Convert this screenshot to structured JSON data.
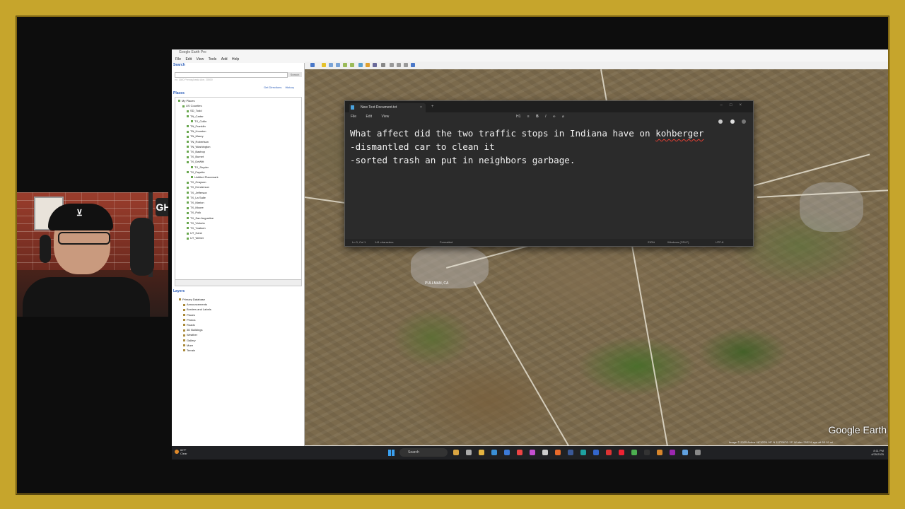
{
  "colors": {
    "frame": "#c6a52c",
    "notepad_bg": "#2b2b2b",
    "spell_error": "#e03c31",
    "link_blue": "#2a5cb8"
  },
  "webcam": {
    "logo_text": "GH"
  },
  "google_earth": {
    "title": "Google Earth Pro",
    "menu": [
      "File",
      "Edit",
      "View",
      "Tools",
      "Add",
      "Help"
    ],
    "search_header": "Search",
    "search_button": "Search",
    "search_hint": "ex: 1600 Pennsylvania Ave, 20500",
    "links": [
      "Get Directions",
      "History"
    ],
    "places_header": "Places",
    "tree": [
      "My Places",
      "US Counties",
      "SD_Todd",
      "TN_Carter",
      "TX_Collin",
      "TN_Franklin",
      "TN_Houston",
      "TN_Maury",
      "TN_Robertson",
      "TN_Washington",
      "TX_Bastrop",
      "TX_Burnet",
      "TX_DeWitt",
      "TX_Snyder",
      "TX_Fayette",
      "Untitled Placemark",
      "TX_Grayson",
      "TX_Henderson",
      "TX_Jefferson",
      "TX_La Salle",
      "TX_Marion",
      "TX_Moore",
      "TX_Polk",
      "TX_San Augustine",
      "TX_Victoria",
      "TX_Yoakum",
      "UT_Kane",
      "UT_Weber"
    ],
    "layers_header": "Layers",
    "layers": [
      "Primary Database",
      "Announcements",
      "Borders and Labels",
      "Places",
      "Photos",
      "Roads",
      "3D Buildings",
      "Weather",
      "Gallery",
      "More",
      "Terrain"
    ],
    "map_logo": "Google Earth",
    "map_town_label": "PULLMAN, CA",
    "status_text": "Image © 2025 Airbus  46°43'24.95\" N 117°08'32.13\" W  elev 2532 ft  eye alt 53.19 mi"
  },
  "notepad": {
    "tab_title": "New Text Document.txt",
    "menu": [
      "File",
      "Edit",
      "View"
    ],
    "format_controls": [
      "H1",
      "≡",
      "B",
      "I",
      "∞",
      "⌀"
    ],
    "line1_before": "What affect did the two traffic stops in Indiana have on ",
    "line1_misspelled": "kohberger",
    "line2": "-dismantled car to clean it",
    "line3": "-sorted trash an put in neighbors garbage.",
    "status": {
      "position": "Ln 3, Col 1",
      "characters": "141 characters",
      "formatting": "Formatted",
      "zoom": "230%",
      "line_ending": "Windows (CRLF)",
      "encoding": "UTF-8"
    }
  },
  "taskbar": {
    "weather_temp": "62°F",
    "weather_text": "Clear",
    "search_placeholder": "Search",
    "time": "8:11 PM",
    "date": "4/25/2025"
  }
}
